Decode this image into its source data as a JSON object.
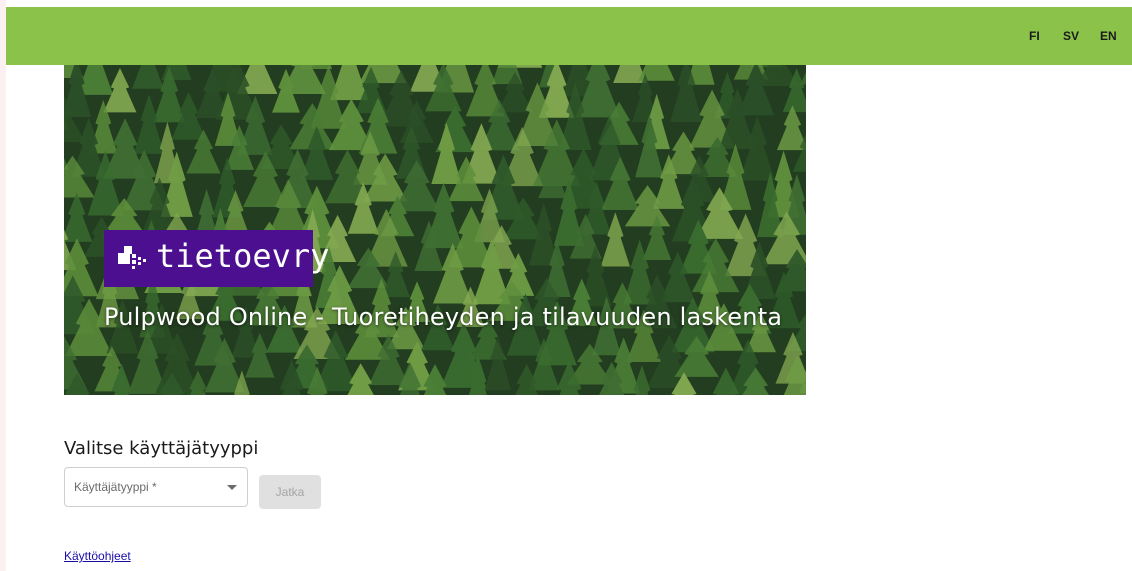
{
  "header": {
    "background": "#8bc34a",
    "languages": [
      "FI",
      "SV",
      "EN"
    ]
  },
  "banner": {
    "logo_text": "tietoevry",
    "logo_background": "#4b0f8f",
    "title": "Pulpwood Online - Tuoretiheyden ja tilavuuden laskenta"
  },
  "main": {
    "heading": "Valitse käyttäjätyyppi",
    "user_type_select": {
      "label": "Käyttäjätyyppi *",
      "icon": "dropdown-arrow-icon"
    },
    "continue_button": {
      "label": "Jatka",
      "enabled": false
    },
    "help_link": "Käyttöohjeet"
  }
}
